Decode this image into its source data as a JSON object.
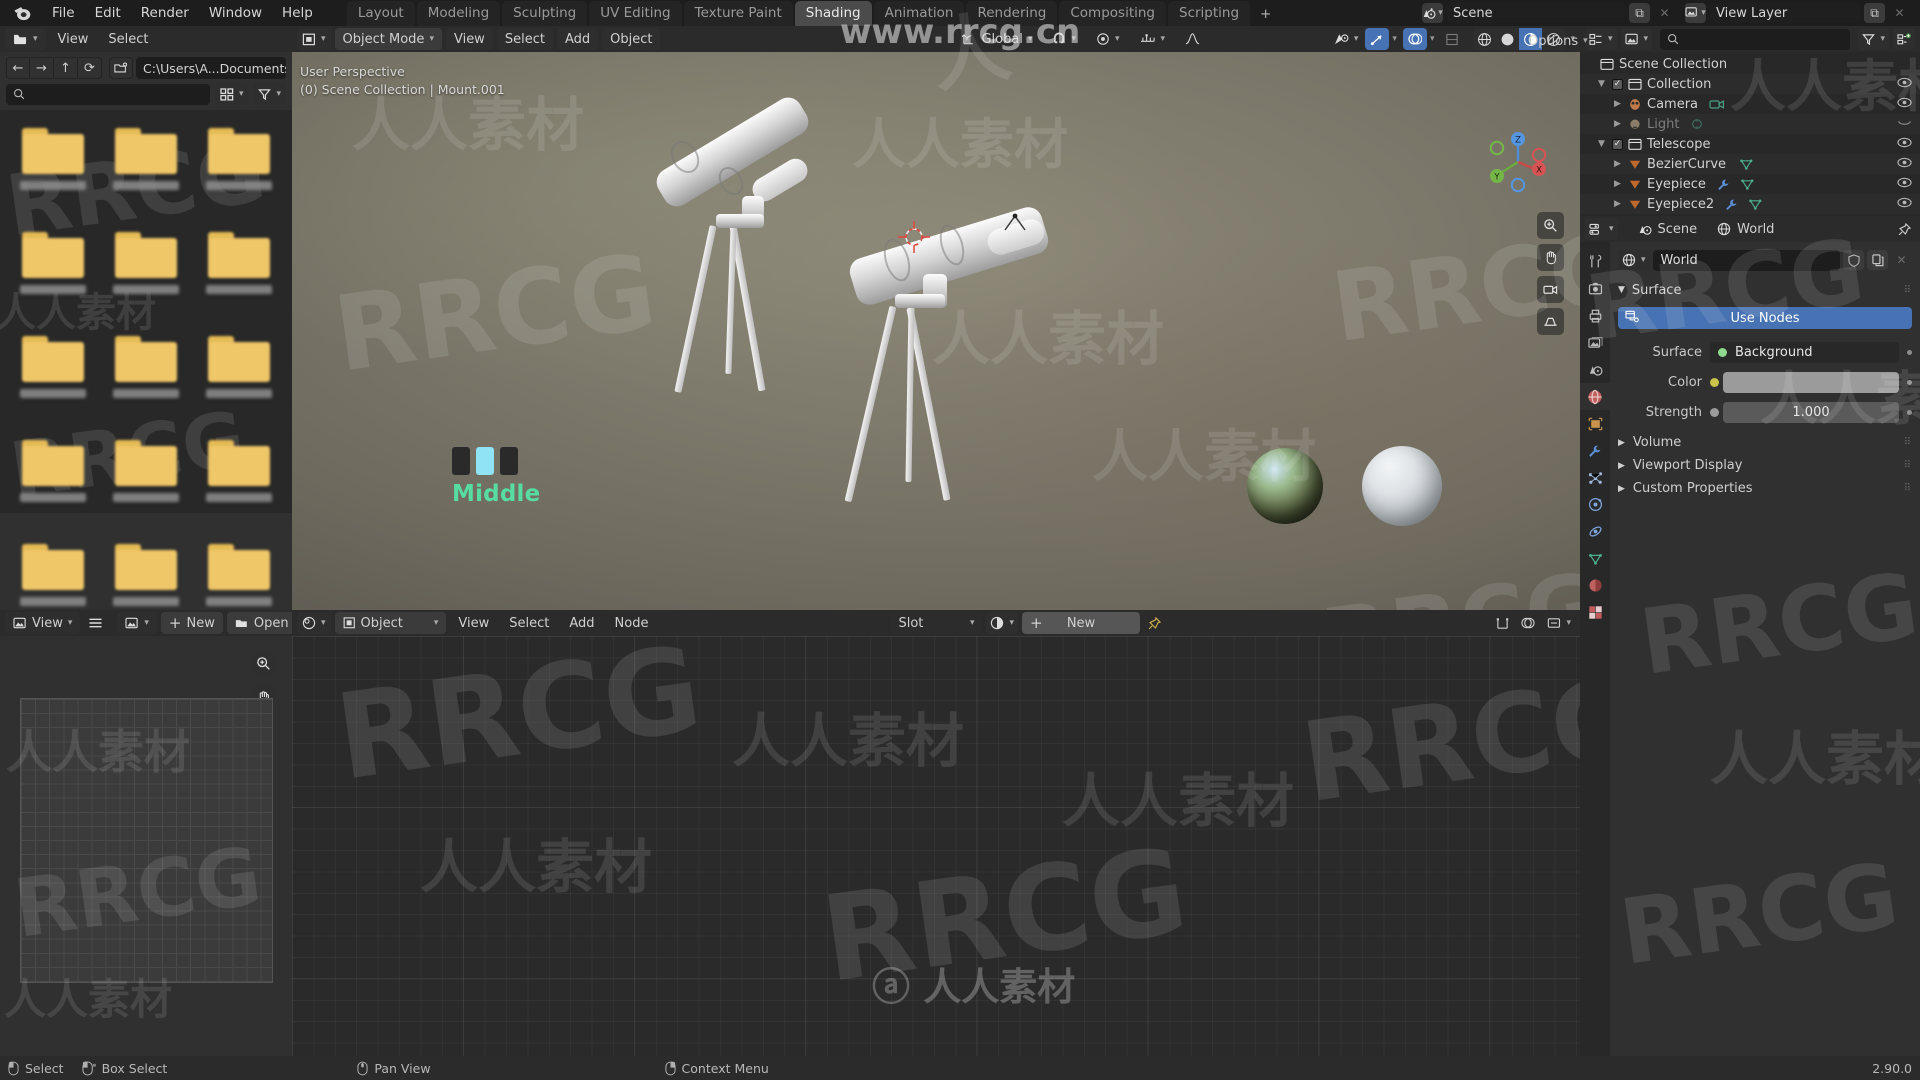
{
  "app": {
    "name": "Blender",
    "version": "2.90.0",
    "logo_icon": "blender-logo-icon"
  },
  "topbar": {
    "menus": [
      "File",
      "Edit",
      "Render",
      "Window",
      "Help"
    ],
    "workspaces": [
      {
        "label": "Layout",
        "active": false
      },
      {
        "label": "Modeling",
        "active": false
      },
      {
        "label": "Sculpting",
        "active": false
      },
      {
        "label": "UV Editing",
        "active": false
      },
      {
        "label": "Texture Paint",
        "active": false
      },
      {
        "label": "Shading",
        "active": true
      },
      {
        "label": "Animation",
        "active": false
      },
      {
        "label": "Rendering",
        "active": false
      },
      {
        "label": "Compositing",
        "active": false
      },
      {
        "label": "Scripting",
        "active": false
      }
    ],
    "add_workspace_label": "+",
    "scene": {
      "icon": "scene-icon",
      "name": "Scene",
      "copy_label": "⧉",
      "close_label": "✕"
    },
    "view_layer": {
      "icon": "view-layer-icon",
      "name": "View Layer",
      "copy_label": "⧉",
      "close_label": "✕"
    }
  },
  "file_browser": {
    "editor_icon": "file-browser-icon",
    "menus": [
      "View",
      "Select"
    ],
    "nav": {
      "back": "←",
      "forward": "→",
      "up": "↑",
      "refresh": "⟳",
      "new_folder": "new-folder-icon"
    },
    "path": "C:\\Users\\A...Documents\\",
    "search_placeholder": "",
    "display_mode_icon": "grid-view-icon",
    "filter_icon": "filter-icon",
    "items_count": 15
  },
  "image_editor": {
    "editor_icon": "image-editor-icon",
    "view_menu": "View",
    "menu_icon": "hamburger-icon",
    "image_icon": "image-datablock-icon",
    "new_label": "New",
    "open_label": "Open",
    "pin_icon": "pin-icon",
    "zoom_icon": "zoom-in-icon",
    "pan_icon": "hand-pan-icon"
  },
  "viewport": {
    "editor_icon": "editor-type-icon",
    "mode": "Object Mode",
    "menus": [
      "View",
      "Select",
      "Add",
      "Object"
    ],
    "transform_orientation": "Global",
    "snap_icon": "magnet-icon",
    "proportional_icon": "proportional-edit-icon",
    "options_label": "Options",
    "overlay_text_line1": "User Perspective",
    "overlay_text_line2": "(0) Scene Collection | Mount.001",
    "mouse_hint_label": "Middle",
    "gizmo_axes": [
      "X",
      "Y",
      "Z"
    ],
    "tools": [
      "zoom-view-icon",
      "hand-pan-icon",
      "camera-view-icon",
      "ortho-persp-icon"
    ],
    "shading_modes": [
      "wireframe-icon",
      "solid-icon",
      "material-preview-icon",
      "rendered-icon"
    ],
    "active_shading_mode": "material-preview-icon"
  },
  "shader_editor": {
    "editor_icon": "shader-editor-icon",
    "shader_type": "Object",
    "menus": [
      "View",
      "Select",
      "Add",
      "Node"
    ],
    "slot_label": "Slot",
    "material_icon": "material-icon",
    "new_label": "New",
    "add_label": "+",
    "pin_icon": "pin-icon",
    "snap_icon": "snap-icon",
    "overlay_icon": "overlay-icon"
  },
  "outliner": {
    "display_mode_icon": "outliner-display-icon",
    "filter_icon": "filter-icon",
    "search_placeholder": "",
    "new_collection_icon": "new-collection-icon",
    "rows": [
      {
        "label": "Scene Collection",
        "indent": 0,
        "icon": "collection-icon",
        "disclosure": "",
        "checkbox": false,
        "eye": false,
        "dim": false,
        "badges": []
      },
      {
        "label": "Collection",
        "indent": 1,
        "icon": "collection-icon",
        "disclosure": "▼",
        "checkbox": true,
        "eye": true,
        "dim": false,
        "badges": []
      },
      {
        "label": "Camera",
        "indent": 2,
        "icon": "camera-object-icon",
        "disclosure": "▶",
        "checkbox": false,
        "eye": true,
        "dim": false,
        "badges": [
          "camera-data-icon"
        ]
      },
      {
        "label": "Light",
        "indent": 2,
        "icon": "light-object-icon",
        "disclosure": "▶",
        "checkbox": false,
        "eye": true,
        "dim": true,
        "badges": [
          "light-data-icon"
        ]
      },
      {
        "label": "Telescope",
        "indent": 1,
        "icon": "collection-icon",
        "disclosure": "▼",
        "checkbox": true,
        "eye": true,
        "dim": false,
        "badges": []
      },
      {
        "label": "BezierCurve",
        "indent": 2,
        "icon": "curve-object-icon",
        "disclosure": "▶",
        "checkbox": false,
        "eye": true,
        "dim": false,
        "badges": [
          "mesh-data-icon"
        ]
      },
      {
        "label": "Eyepiece",
        "indent": 2,
        "icon": "curve-object-icon",
        "disclosure": "▶",
        "checkbox": false,
        "eye": true,
        "dim": false,
        "badges": [
          "modifier-icon",
          "mesh-data-icon"
        ]
      },
      {
        "label": "Eyepiece2",
        "indent": 2,
        "icon": "curve-object-icon",
        "disclosure": "▶",
        "checkbox": false,
        "eye": true,
        "dim": false,
        "badges": [
          "modifier-icon",
          "mesh-data-icon"
        ]
      }
    ]
  },
  "properties": {
    "editor_icon": "properties-editor-icon",
    "breadcrumb": [
      {
        "label": "Scene",
        "icon": "scene-icon"
      },
      {
        "label": "World",
        "icon": "world-icon"
      }
    ],
    "pin_icon": "pin-icon",
    "tabs": [
      {
        "name": "tool",
        "icon": "tool-icon",
        "active": false
      },
      {
        "name": "render",
        "icon": "render-icon",
        "active": false
      },
      {
        "name": "output",
        "icon": "output-printer-icon",
        "active": false
      },
      {
        "name": "view-layer",
        "icon": "view-layer-icon",
        "active": false
      },
      {
        "name": "scene",
        "icon": "scene-icon",
        "active": false
      },
      {
        "name": "world",
        "icon": "world-icon",
        "active": true
      },
      {
        "name": "object",
        "icon": "object-icon",
        "active": false
      },
      {
        "name": "modifiers",
        "icon": "wrench-icon",
        "active": false
      },
      {
        "name": "particles",
        "icon": "particles-icon",
        "active": false
      },
      {
        "name": "physics",
        "icon": "physics-icon",
        "active": false
      },
      {
        "name": "constraints",
        "icon": "constraints-icon",
        "active": false
      },
      {
        "name": "data",
        "icon": "mesh-data-icon",
        "active": false
      },
      {
        "name": "material",
        "icon": "material-icon",
        "active": false
      },
      {
        "name": "texture",
        "icon": "texture-checker-icon",
        "active": false
      }
    ],
    "datablock": {
      "icon": "world-icon",
      "name": "World",
      "shield_icon": "fake-user-icon",
      "copy_icon": "duplicate-icon",
      "close_icon": "unlink-icon"
    },
    "surface_panel": {
      "title": "Surface",
      "use_nodes_label": "Use Nodes",
      "use_nodes_icon": "nodes-icon",
      "use_nodes_color": "#4772b3",
      "fields": [
        {
          "label": "Surface",
          "value": "Background",
          "socket_color": "#8fd98f",
          "type": "enum"
        },
        {
          "label": "Color",
          "value": "",
          "socket_color": "#ccc34a",
          "type": "color",
          "swatch": "#9b9b9b"
        },
        {
          "label": "Strength",
          "value": "1.000",
          "socket_color": "#9b9b9b",
          "type": "number"
        }
      ]
    },
    "collapsed_panels": [
      "Volume",
      "Viewport Display",
      "Custom Properties"
    ]
  },
  "statusbar": {
    "left_items": [
      {
        "icon": "mouse-left-icon",
        "label": "Select"
      },
      {
        "icon": "mouse-left-drag-icon",
        "label": "Box Select"
      }
    ],
    "mid_items": [
      {
        "icon": "mouse-middle-icon",
        "label": "Pan View"
      }
    ],
    "right_items": [
      {
        "icon": "mouse-right-icon",
        "label": "Context Menu"
      }
    ],
    "version": "2.90.0"
  },
  "watermarks": {
    "site": "www.rrcg.cn",
    "brand": "RRCG",
    "cn_text": "人人素材"
  }
}
